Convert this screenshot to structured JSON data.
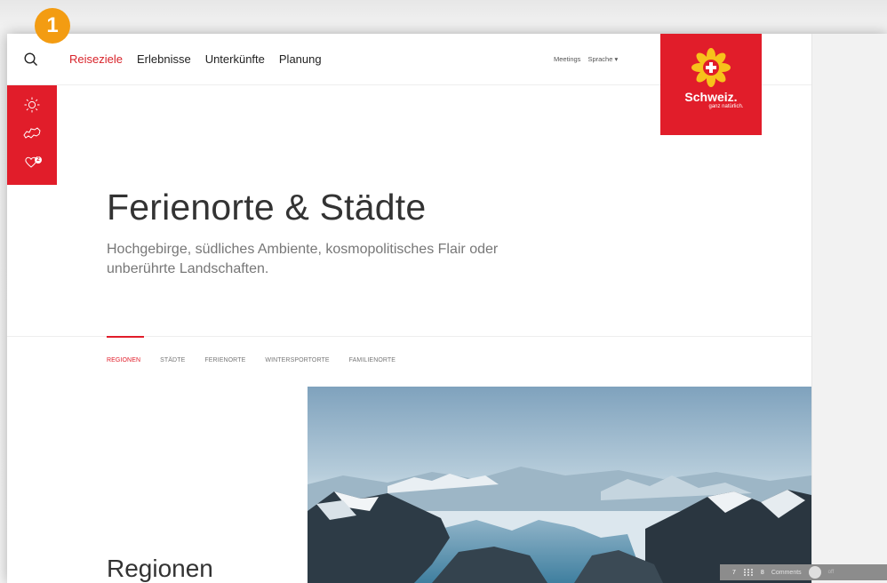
{
  "step": {
    "number": "1"
  },
  "nav": {
    "items": [
      {
        "label": "Reiseziele",
        "active": true
      },
      {
        "label": "Erlebnisse",
        "active": false
      },
      {
        "label": "Unterkünfte",
        "active": false
      },
      {
        "label": "Planung",
        "active": false
      }
    ],
    "meta": [
      {
        "label": "Meetings"
      },
      {
        "label": "Sprache ▾"
      }
    ]
  },
  "logo": {
    "word": "Schweiz.",
    "tagline": "ganz natürlich."
  },
  "sidebar": {
    "favorites_count": "2"
  },
  "hero": {
    "title": "Ferienorte & Städte",
    "subtitle": "Hochgebirge, südliches Ambiente, kosmopolitisches Flair oder unberührte Landschaften."
  },
  "tabs": [
    {
      "label": "REGIONEN",
      "active": true
    },
    {
      "label": "STÄDTE",
      "active": false
    },
    {
      "label": "FERIENORTE",
      "active": false
    },
    {
      "label": "WINTERSPORTORTE",
      "active": false
    },
    {
      "label": "FAMILIENORTE",
      "active": false
    }
  ],
  "section": {
    "title": "Regionen"
  },
  "review": {
    "page_a": "7",
    "page_b": "8",
    "comments_label": "Comments",
    "toggle_state": "off"
  },
  "colors": {
    "brand_red": "#e11d2a",
    "nav_active": "#d8232a",
    "badge": "#f39c12"
  }
}
